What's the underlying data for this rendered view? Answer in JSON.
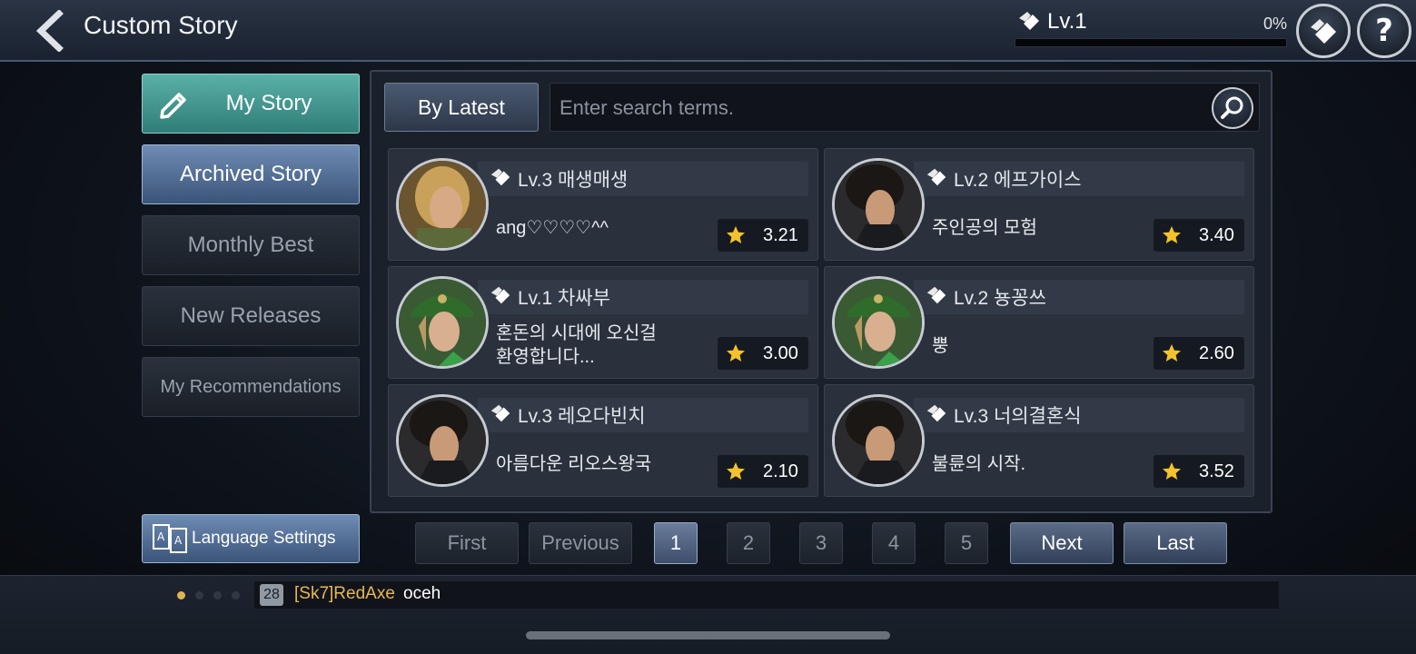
{
  "header": {
    "title": "Custom Story",
    "level": "Lv.1",
    "level_progress_text": "0%",
    "level_progress": 0
  },
  "sidebar": {
    "items": [
      {
        "label": "My Story"
      },
      {
        "label": "Archived Story"
      },
      {
        "label": "Monthly Best"
      },
      {
        "label": "New Releases"
      },
      {
        "label": "My Recommendations"
      }
    ],
    "language_button": "Language Settings"
  },
  "main": {
    "sort_label": "By Latest",
    "search_placeholder": "Enter search terms.",
    "stories": [
      {
        "level_title": "Lv.3 매생매생",
        "description": "ang♡♡♡♡^^",
        "rating": "3.21",
        "avatar": "blonde"
      },
      {
        "level_title": "Lv.2 에프가이스",
        "description": "주인공의 모험",
        "rating": "3.40",
        "avatar": "dark"
      },
      {
        "level_title": "Lv.1 차싸부",
        "description": "혼돈의 시대에 오신걸\n환영합니다...",
        "rating": "3.00",
        "avatar": "green"
      },
      {
        "level_title": "Lv.2 뇽꽁쓰",
        "description": "뿡",
        "rating": "2.60",
        "avatar": "green"
      },
      {
        "level_title": "Lv.3 레오다빈치",
        "description": "아름다운 리오스왕국",
        "rating": "2.10",
        "avatar": "dark"
      },
      {
        "level_title": "Lv.3 너의결혼식",
        "description": "불륜의 시작.",
        "rating": "3.52",
        "avatar": "dark"
      }
    ]
  },
  "pagination": {
    "first": "First",
    "previous": "Previous",
    "pages": [
      "1",
      "2",
      "3",
      "4",
      "5"
    ],
    "current_page": "1",
    "next": "Next",
    "last": "Last"
  },
  "chat": {
    "badge": "28",
    "user": "[Sk7]RedAxe",
    "message": "oceh"
  },
  "colors": {
    "accent_teal": "#2f7e78",
    "accent_blue": "#3b5479",
    "gold": "#e9b656"
  }
}
